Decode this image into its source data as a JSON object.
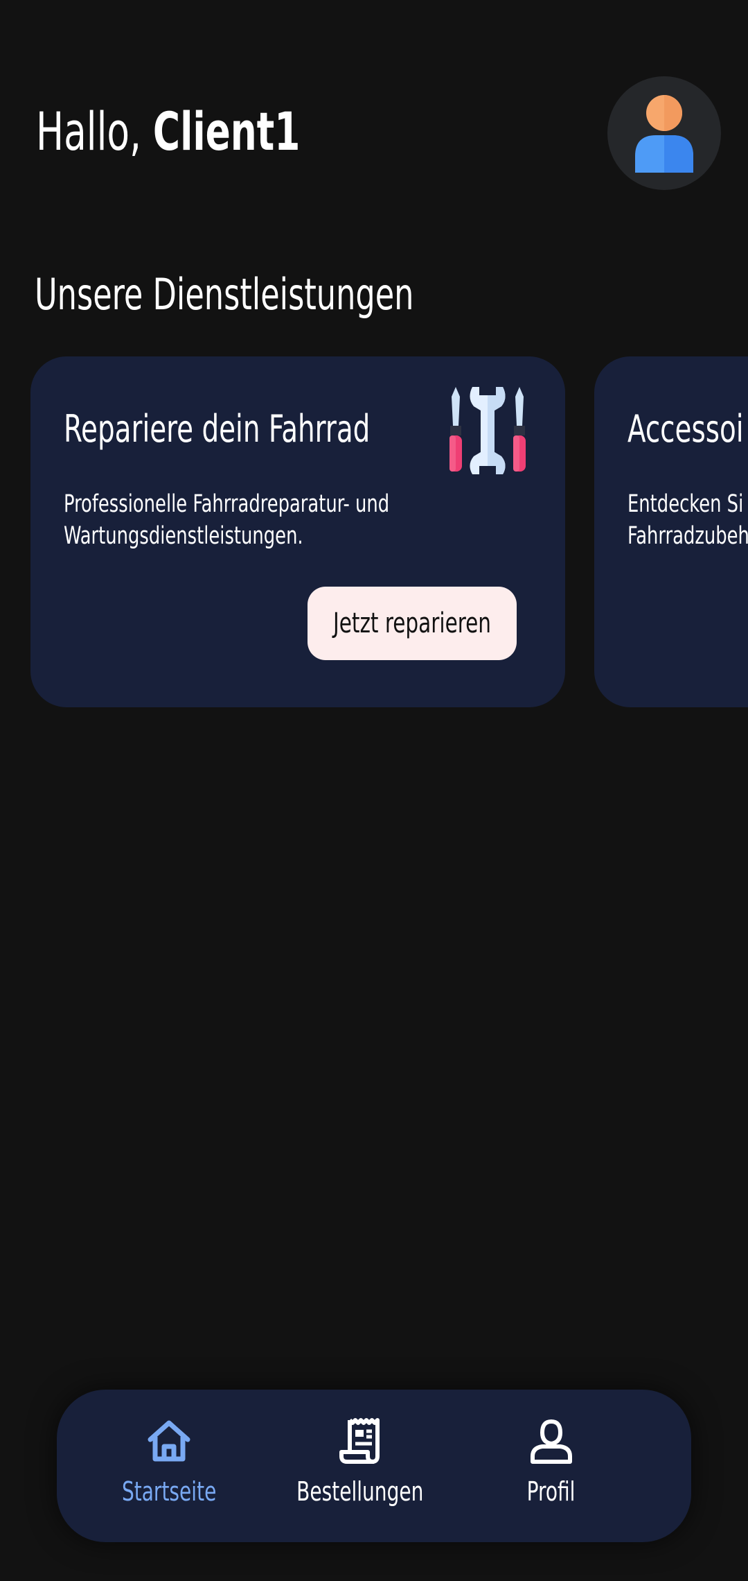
{
  "header": {
    "greeting_prefix": "Hallo, ",
    "user_name": "Client1"
  },
  "section": {
    "title": "Unsere Dienstleistungen"
  },
  "services": [
    {
      "title": "Repariere dein Fahrrad",
      "description": "Professionelle Fahrradreparatur- und Wartungsdienstleistungen.",
      "button_label": "Jetzt reparieren",
      "icon": "tools-icon"
    },
    {
      "title": "Accessoi",
      "description_line1": "Entdecken Si",
      "description_line2": "Fahrradzubeh",
      "icon": "accessories-icon"
    }
  ],
  "nav": {
    "items": [
      {
        "label": "Startseite",
        "icon": "home-icon",
        "active": true
      },
      {
        "label": "Bestellungen",
        "icon": "receipt-icon",
        "active": false
      },
      {
        "label": "Profil",
        "icon": "user-icon",
        "active": false
      }
    ]
  },
  "colors": {
    "background": "#121212",
    "card": "#18203a",
    "accent": "#79a9f3",
    "button_bg": "#fdeded"
  }
}
